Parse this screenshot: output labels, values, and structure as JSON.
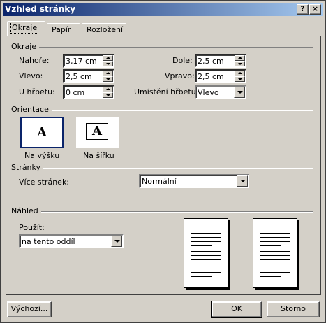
{
  "window": {
    "title": "Vzhled stránky",
    "help_label": "?",
    "close_label": "×"
  },
  "tabs": [
    {
      "label": "Okraje",
      "active": true
    },
    {
      "label": "Papír",
      "active": false
    },
    {
      "label": "Rozložení",
      "active": false
    }
  ],
  "margins": {
    "section_label": "Okraje",
    "top": {
      "label": "Nahoře:",
      "value": "3,17 cm"
    },
    "left": {
      "label": "Vlevo:",
      "value": "2,5 cm"
    },
    "gutter": {
      "label": "U hřbetu:",
      "value": "0 cm"
    },
    "bottom": {
      "label": "Dole:",
      "value": "2,5 cm"
    },
    "right": {
      "label": "Vpravo:",
      "value": "2,5 cm"
    },
    "gutter_position": {
      "label": "Umístění hřbetu:",
      "value": "Vlevo"
    }
  },
  "orientation": {
    "section_label": "Orientace",
    "portrait": {
      "label": "Na výšku",
      "glyph": "A",
      "selected": true
    },
    "landscape": {
      "label": "Na šířku",
      "glyph": "A",
      "selected": false
    }
  },
  "pages": {
    "section_label": "Stránky",
    "multiple_label": "Více stránek:",
    "multiple_value": "Normální"
  },
  "preview": {
    "section_label": "Náhled",
    "apply_label": "Použít:",
    "apply_value": "na tento oddíl"
  },
  "buttons": {
    "default": "Výchozí...",
    "ok": "OK",
    "cancel": "Storno"
  }
}
